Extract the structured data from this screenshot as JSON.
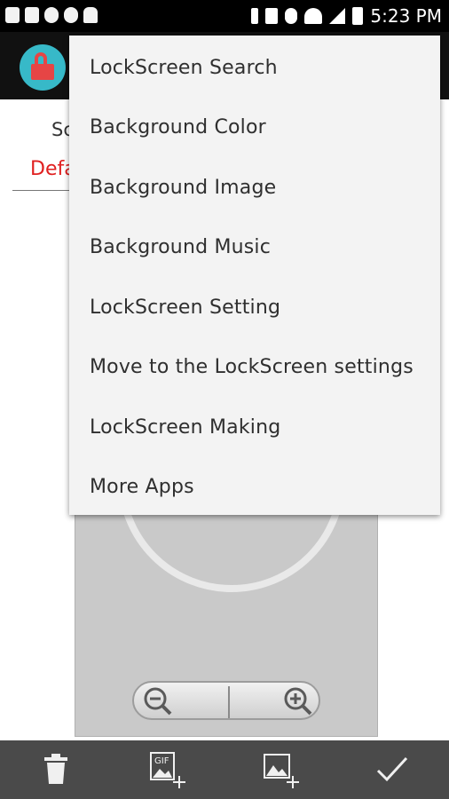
{
  "status_bar": {
    "time": "5:23 PM",
    "left_icons": [
      "notification-icon-1",
      "gallery-icon",
      "chat-icon",
      "watch-icon",
      "android-icon"
    ],
    "right_icons": [
      "bluetooth-icon",
      "vibrate-icon",
      "settings-icon",
      "wifi-icon",
      "signal-icon",
      "battery-icon"
    ]
  },
  "content": {
    "label_partial": "Sc",
    "red_partial": "Defa"
  },
  "menu": {
    "items": [
      {
        "label": "LockScreen Search"
      },
      {
        "label": "Background Color"
      },
      {
        "label": "Background Image"
      },
      {
        "label": "Background Music"
      },
      {
        "label": "LockScreen Setting"
      },
      {
        "label": "Move to the LockScreen settings"
      },
      {
        "label": "LockScreen Making"
      },
      {
        "label": "More Apps"
      }
    ]
  },
  "bottom_bar": {
    "buttons": [
      "trash-icon",
      "add-gif-icon",
      "add-image-icon",
      "check-icon"
    ]
  },
  "colors": {
    "accent_red": "#e02020",
    "app_icon_teal": "#37b9c8",
    "menu_bg": "#f3f3f3"
  }
}
